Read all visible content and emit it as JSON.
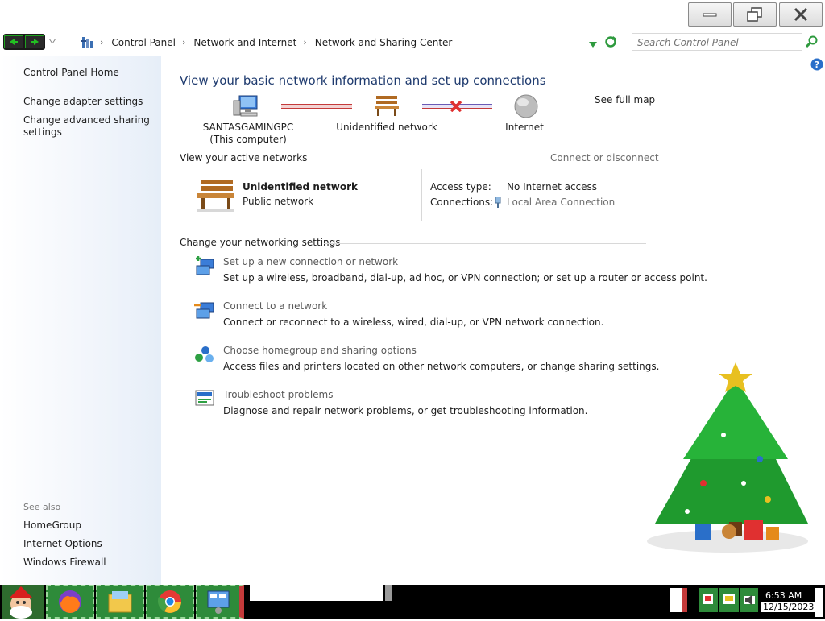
{
  "window": {
    "minimize_label": "",
    "colors": {
      "title_bg": "#ffffff",
      "sidebar_tint": "#e6eef8",
      "title_text": "#1e3a6e"
    }
  },
  "address": {
    "crumbs": [
      "Control Panel",
      "Network and Internet",
      "Network and Sharing Center"
    ],
    "search_placeholder": "Search Control Panel"
  },
  "sidebar": {
    "home": "Control Panel Home",
    "tasks": [
      "Change adapter settings",
      "Change advanced sharing settings"
    ],
    "see_also_label": "See also",
    "see_also": [
      "HomeGroup",
      "Internet Options",
      "Windows Firewall"
    ]
  },
  "main": {
    "title": "View your basic network information and set up connections",
    "map": {
      "computer_name": "SANTASGAMINGPC",
      "computer_sub": "(This computer)",
      "network": "Unidentified network",
      "internet": "Internet",
      "see_full_map": "See full map"
    },
    "active": {
      "heading": "View your active networks",
      "connect_link": "Connect or disconnect",
      "name": "Unidentified network",
      "type": "Public network",
      "access_label": "Access type:",
      "access_value": "No Internet access",
      "connections_label": "Connections:",
      "connections_value": "Local Area Connection"
    },
    "settings": {
      "heading": "Change your networking settings",
      "items": [
        {
          "link": "Set up a new connection or network",
          "desc": "Set up a wireless, broadband, dial-up, ad hoc, or VPN connection; or set up a router or access point."
        },
        {
          "link": "Connect to a network",
          "desc": "Connect or reconnect to a wireless, wired, dial-up, or VPN network connection."
        },
        {
          "link": "Choose homegroup and sharing options",
          "desc": "Access files and printers located on other network computers, or change sharing settings."
        },
        {
          "link": "Troubleshoot problems",
          "desc": "Diagnose and repair network problems, or get troubleshooting information."
        }
      ]
    }
  },
  "taskbar": {
    "time": "6:53 AM",
    "date": "12/15/2023",
    "apps": [
      "firefox-icon",
      "file-explorer-icon",
      "chrome-icon",
      "network-control-icon"
    ]
  }
}
